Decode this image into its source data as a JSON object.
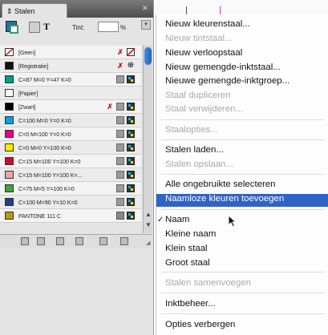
{
  "panel": {
    "tab_label": "⇕ Stalen",
    "tint_label": "Tint:",
    "tint_value": "",
    "tint_percent": "%",
    "swatches": [
      {
        "name": "[Geen]",
        "color": "#ffffff",
        "icons": [
          "x",
          "none"
        ]
      },
      {
        "name": "[Registratie]",
        "color": "#111111",
        "icons": [
          "x",
          "reg"
        ]
      },
      {
        "name": "C=87 M=0 Y=47 K=0",
        "color": "#009c8c",
        "icons": [
          "proc",
          "cmyk"
        ]
      },
      {
        "name": "[Papier]",
        "color": "#ffffff",
        "icons": []
      },
      {
        "name": "[Zwart]",
        "color": "#000000",
        "icons": [
          "x",
          "proc",
          "cmyk"
        ]
      },
      {
        "name": "C=100 M=0 Y=0 K=0",
        "color": "#00a3e0",
        "icons": [
          "proc",
          "cmyk"
        ]
      },
      {
        "name": "C=0 M=100 Y=0 K=0",
        "color": "#e4007c",
        "icons": [
          "proc",
          "cmyk"
        ]
      },
      {
        "name": "C=0 M=0 Y=100 K=0",
        "color": "#ffec00",
        "icons": [
          "proc",
          "cmyk"
        ]
      },
      {
        "name": "C=15 M=100 Y=100 K=0",
        "color": "#c8102e",
        "icons": [
          "proc",
          "cmyk"
        ]
      },
      {
        "name": "C=15 M=100 Y=100 K=...",
        "color": "#e8a9a0",
        "icons": [
          "proc",
          "cmyk"
        ]
      },
      {
        "name": "C=75 M=5 Y=100 K=0",
        "color": "#3ea33a",
        "icons": [
          "proc",
          "cmyk"
        ]
      },
      {
        "name": "C=100 M=90 Y=10 K=0",
        "color": "#1d3f8f",
        "icons": [
          "proc",
          "cmyk"
        ]
      },
      {
        "name": "PANTONE 111 C",
        "color": "#b49a1a",
        "icons": [
          "spot",
          "cmyk"
        ]
      }
    ]
  },
  "menu": {
    "items": [
      {
        "label": "Nieuw kleurenstaal...",
        "enabled": true
      },
      {
        "label": "Nieuw tintstaal...",
        "enabled": false
      },
      {
        "label": "Nieuw verloopstaal",
        "enabled": true
      },
      {
        "label": "Nieuw gemengde-inktstaal...",
        "enabled": true
      },
      {
        "label": "Nieuwe gemengde-inktgroep...",
        "enabled": true
      },
      {
        "label": "Staal dupliceren",
        "enabled": false
      },
      {
        "label": "Staal verwijderen...",
        "enabled": false
      },
      {
        "label": "Staalopties...",
        "enabled": false
      },
      {
        "label": "Stalen laden...",
        "enabled": true
      },
      {
        "label": "Stalen opslaan...",
        "enabled": false
      },
      {
        "label": "Alle ongebruikte selecteren",
        "enabled": true
      },
      {
        "label": "Naamloze kleuren toevoegen",
        "enabled": true,
        "highlighted": true
      },
      {
        "label": "Naam",
        "enabled": true,
        "checked": true
      },
      {
        "label": "Kleine naam",
        "enabled": true
      },
      {
        "label": "Klein staal",
        "enabled": true
      },
      {
        "label": "Groot staal",
        "enabled": true
      },
      {
        "label": "Stalen samenvoegen",
        "enabled": false
      },
      {
        "label": "Inktbeheer...",
        "enabled": true
      },
      {
        "label": "Opties verbergen",
        "enabled": true
      }
    ],
    "highlight_color": "#2f63c6"
  }
}
